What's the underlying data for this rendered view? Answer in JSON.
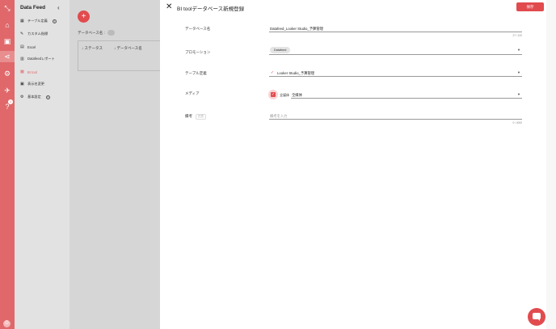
{
  "sidebar": {
    "title": "Data Feed",
    "items": [
      {
        "label": "テーブル定義",
        "icon": "table-icon",
        "help": true
      },
      {
        "label": "カスタム指標",
        "icon": "wrench-icon",
        "help": false
      },
      {
        "label": "Excel",
        "icon": "excel-icon",
        "help": false
      },
      {
        "label": "Datafeedレポート",
        "icon": "bar-chart-icon",
        "help": false
      },
      {
        "label": "BI tool",
        "icon": "bi-tool-icon",
        "help": false,
        "active": true
      },
      {
        "label": "表示名変更",
        "icon": "rename-icon",
        "help": false
      },
      {
        "label": "基本設定",
        "icon": "gear-icon",
        "help": true
      }
    ]
  },
  "rail": {
    "badge": "1",
    "avatar": "G"
  },
  "main": {
    "fab": "+",
    "db_name_label": "データベース名 :",
    "columns": [
      "ステータス",
      "データベース名"
    ]
  },
  "drawer": {
    "title": "BI toolデータベース新規登録",
    "save_label": "保存",
    "fields": {
      "db_name": {
        "label": "データベース名",
        "value": "Datafeed_Looker Studio_予算管理",
        "counter": "27 / 100"
      },
      "promotion": {
        "label": "プロモーション",
        "value": "Datafeed"
      },
      "table": {
        "label": "テーブル定義",
        "value": "Looker Studio_予算管理"
      },
      "media": {
        "label": "メディア",
        "checkbox_label": "全媒体",
        "value": "全媒体"
      },
      "note": {
        "label": "備考",
        "optional": "任意",
        "placeholder": "備考を入力",
        "counter": "0 / 4000"
      }
    }
  },
  "colors": {
    "accent": "#e14b4e",
    "rail": "#e0686a"
  }
}
